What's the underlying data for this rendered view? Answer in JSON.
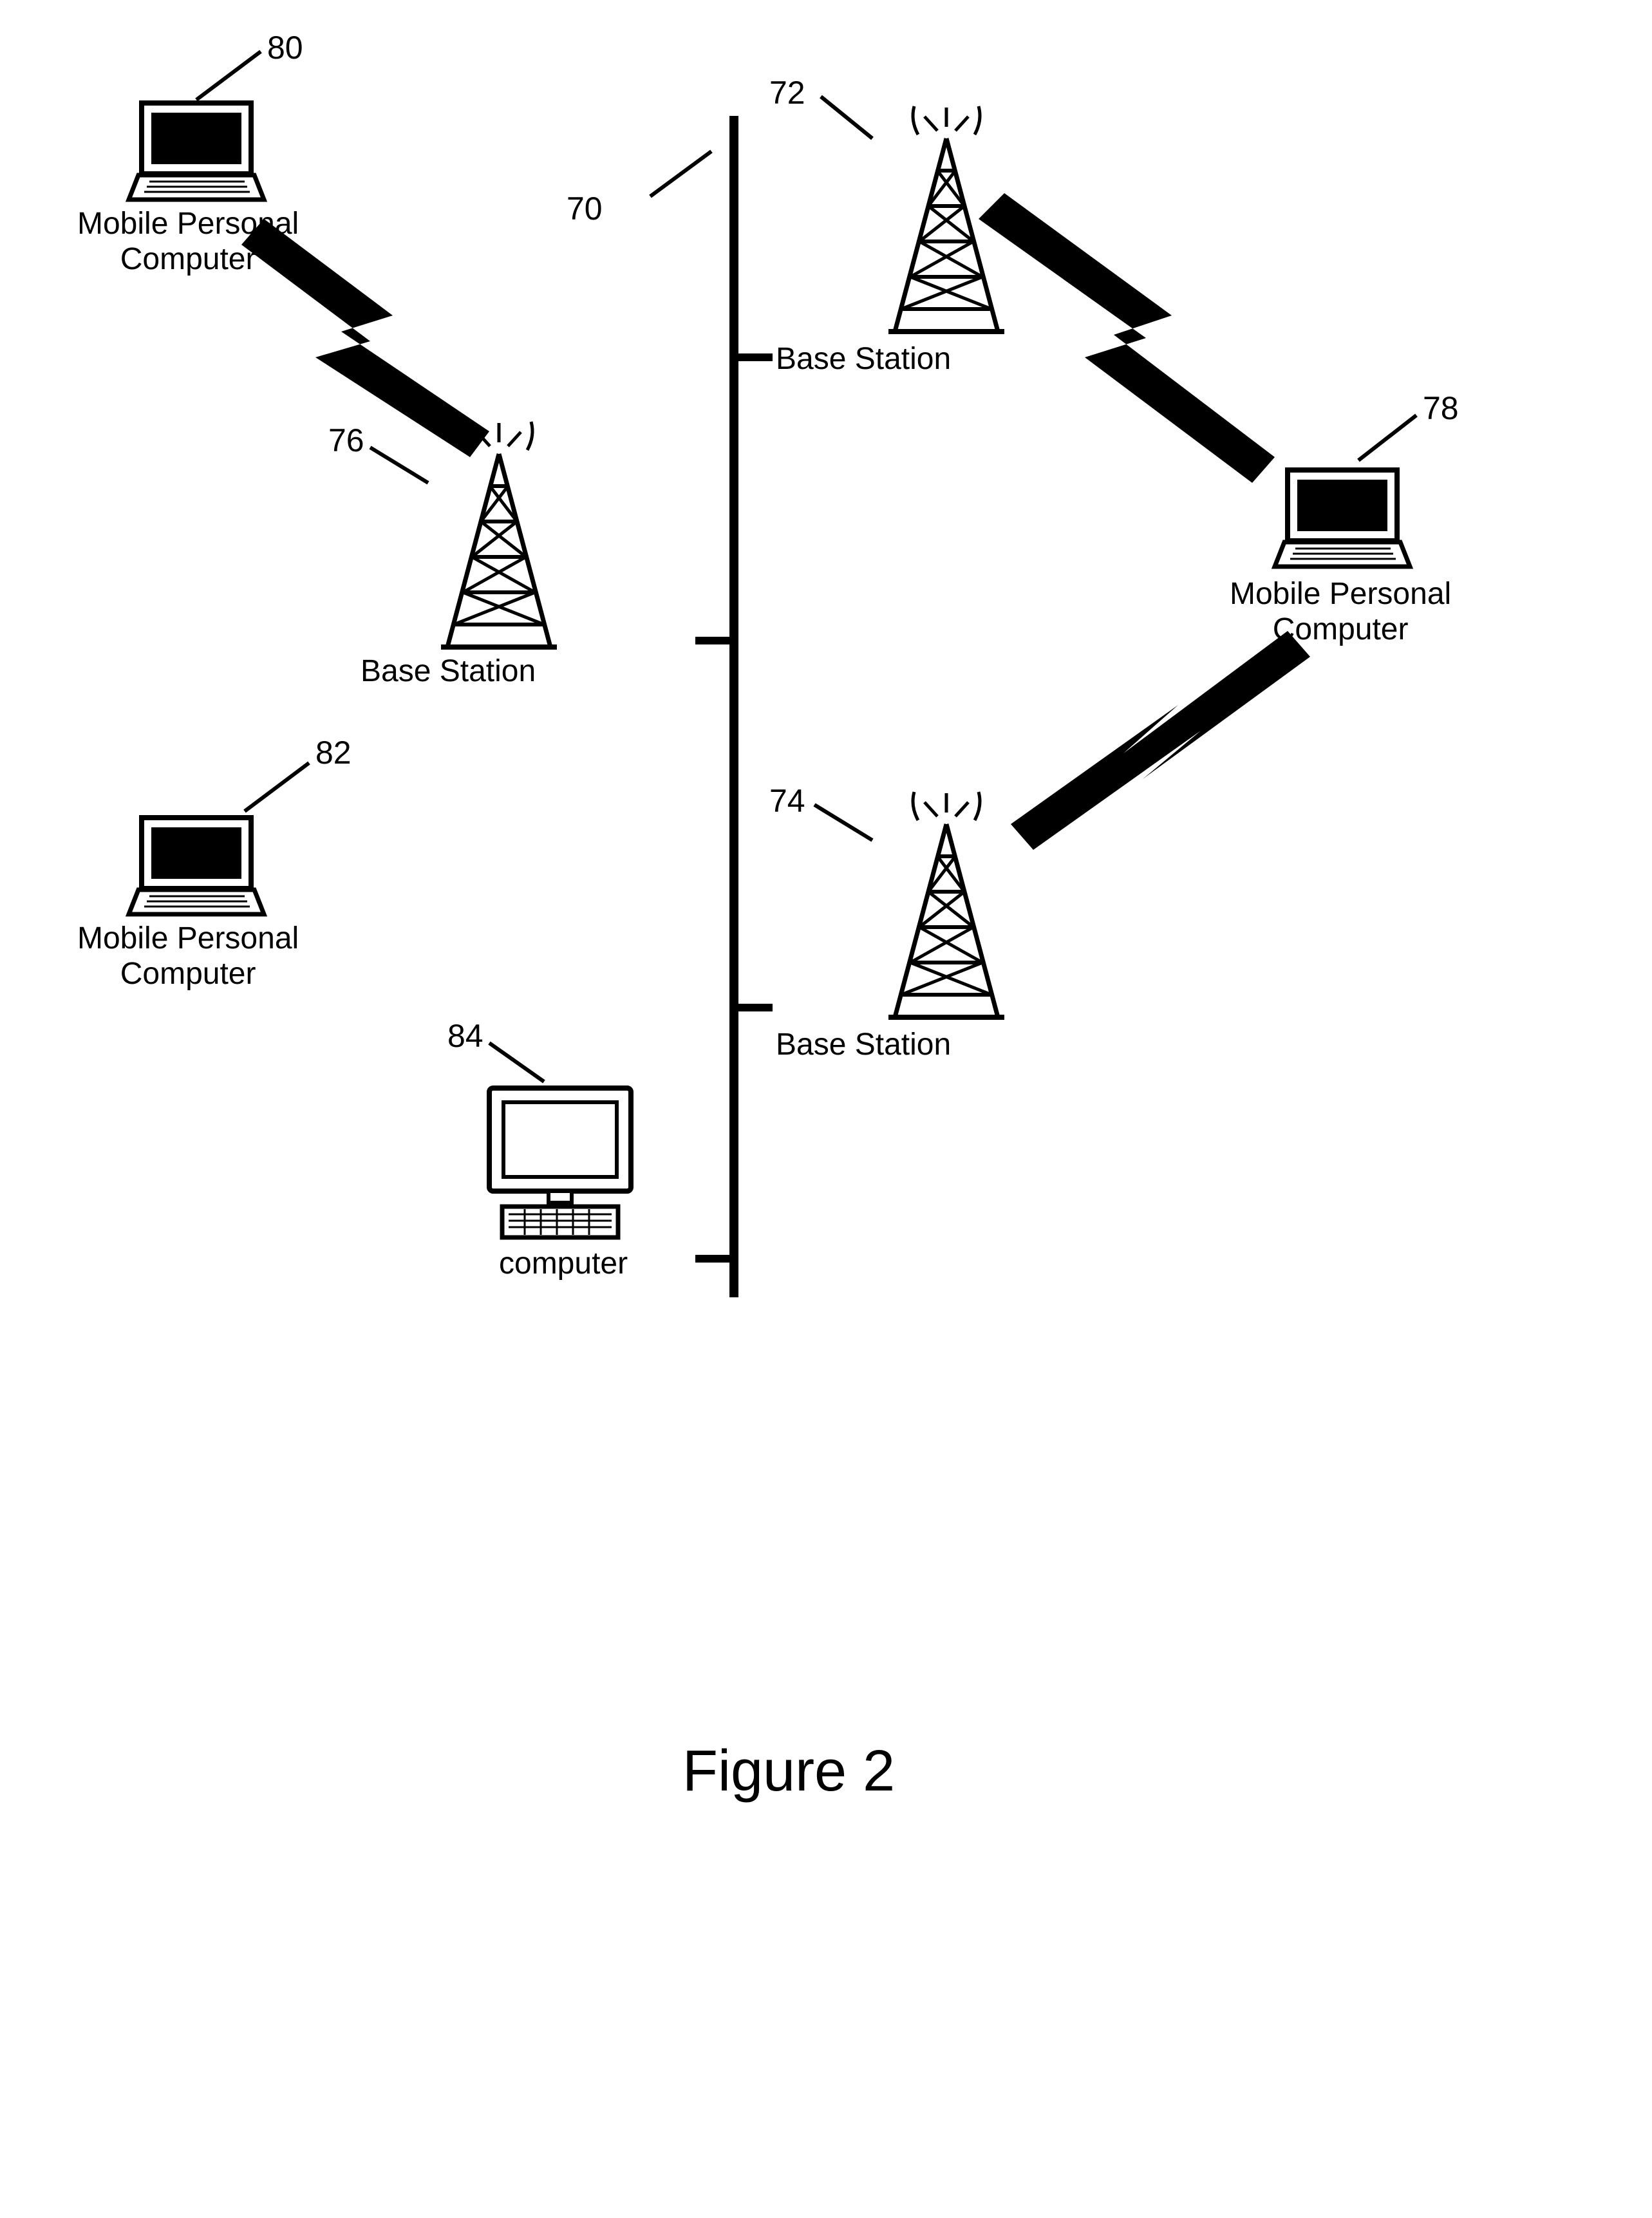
{
  "figure_caption": "Figure 2",
  "bus": {
    "ref": "70"
  },
  "nodes": {
    "bs72": {
      "ref": "72",
      "label": "Base Station"
    },
    "bs74": {
      "ref": "74",
      "label": "Base Station"
    },
    "bs76": {
      "ref": "76",
      "label": "Base Station"
    },
    "mpc78": {
      "ref": "78",
      "label": "Mobile Personal\nComputer"
    },
    "mpc80": {
      "ref": "80",
      "label": "Mobile Personal\nComputer"
    },
    "mpc82": {
      "ref": "82",
      "label": "Mobile Personal\nComputer"
    },
    "comp84": {
      "ref": "84",
      "label": "computer"
    }
  }
}
